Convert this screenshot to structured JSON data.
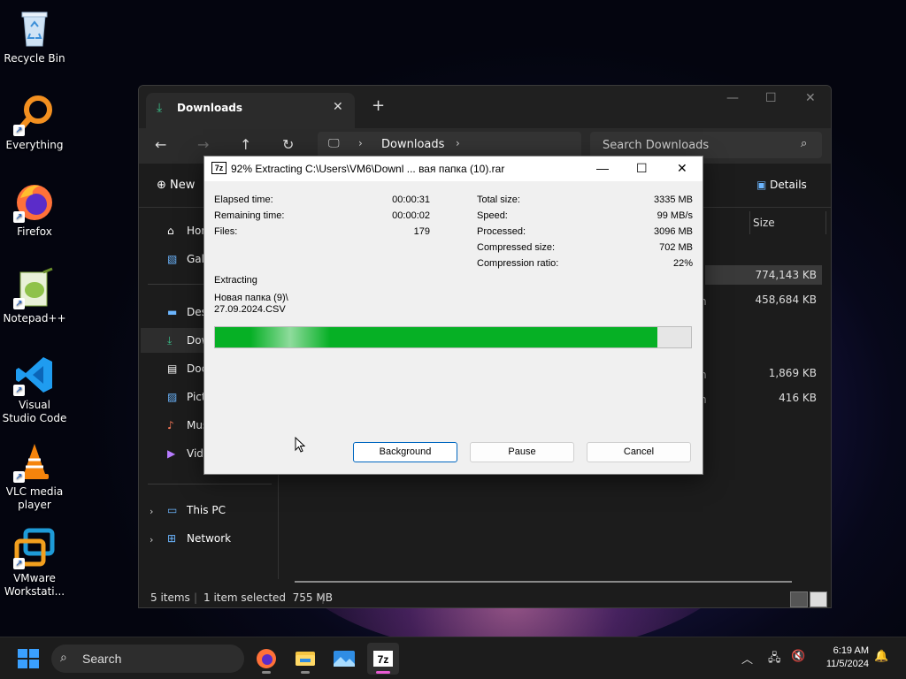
{
  "desktop": {
    "icons": [
      {
        "label": "Recycle Bin",
        "icon": "recycle-bin-icon"
      },
      {
        "label": "Everything",
        "icon": "everything-search-icon"
      },
      {
        "label": "Firefox",
        "icon": "firefox-icon"
      },
      {
        "label": "Notepad++",
        "icon": "notepad-plus-plus-icon"
      },
      {
        "label": "Visual Studio Code",
        "icon": "vscode-icon"
      },
      {
        "label": "VLC media player",
        "icon": "vlc-icon"
      },
      {
        "label": "VMware Workstati...",
        "icon": "vmware-icon"
      }
    ]
  },
  "explorer": {
    "tab_label": "Downloads",
    "address_path": "Downloads",
    "search_placeholder": "Search Downloads",
    "new_label": "New",
    "details_label": "Details",
    "sidebar": {
      "items": [
        {
          "label": "Home",
          "icon": "home-icon"
        },
        {
          "label": "Gallery",
          "icon": "gallery-icon"
        },
        {
          "label": "Desktop",
          "icon": "desktop-folder-icon"
        },
        {
          "label": "Downloads",
          "icon": "download-icon"
        },
        {
          "label": "Documents",
          "icon": "documents-icon"
        },
        {
          "label": "Pictures",
          "icon": "pictures-icon"
        },
        {
          "label": "Music",
          "icon": "music-icon"
        },
        {
          "label": "Videos",
          "icon": "videos-icon"
        }
      ],
      "this_pc": "This PC",
      "network": "Network"
    },
    "column_size": "Size",
    "sizes": [
      "774,143 KB",
      "458,684 KB",
      "1,869 KB",
      "416 KB"
    ],
    "status": {
      "items": "5 items",
      "selected": "1 item selected  755 MB"
    }
  },
  "dialog": {
    "app_badge": "7z",
    "title": "92% Extracting C:\\Users\\VM6\\Downl ... вая папка (10).rar",
    "left_stats": [
      {
        "label": "Elapsed time:",
        "value": "00:00:31"
      },
      {
        "label": "Remaining time:",
        "value": "00:00:02"
      },
      {
        "label": "Files:",
        "value": "179"
      }
    ],
    "right_stats": [
      {
        "label": "Total size:",
        "value": "3335 MB"
      },
      {
        "label": "Speed:",
        "value": "99 MB/s"
      },
      {
        "label": "Processed:",
        "value": "3096 MB"
      },
      {
        "label": "Compressed size:",
        "value": "702 MB"
      },
      {
        "label": "Compression ratio:",
        "value": "22%"
      }
    ],
    "status_label": "Extracting",
    "current_folder": "Новая папка (9)\\",
    "current_file": "27.09.2024.CSV",
    "progress_fraction": 0.93,
    "progress_color": "#06b025",
    "buttons": {
      "background": "Background",
      "pause": "Pause",
      "cancel": "Cancel"
    }
  },
  "taskbar": {
    "search_placeholder": "Search",
    "apps": [
      "firefox-icon",
      "file-explorer-icon",
      "image-viewer-icon",
      "7zip-icon"
    ],
    "time": "6:19 AM",
    "date": "11/5/2024"
  }
}
